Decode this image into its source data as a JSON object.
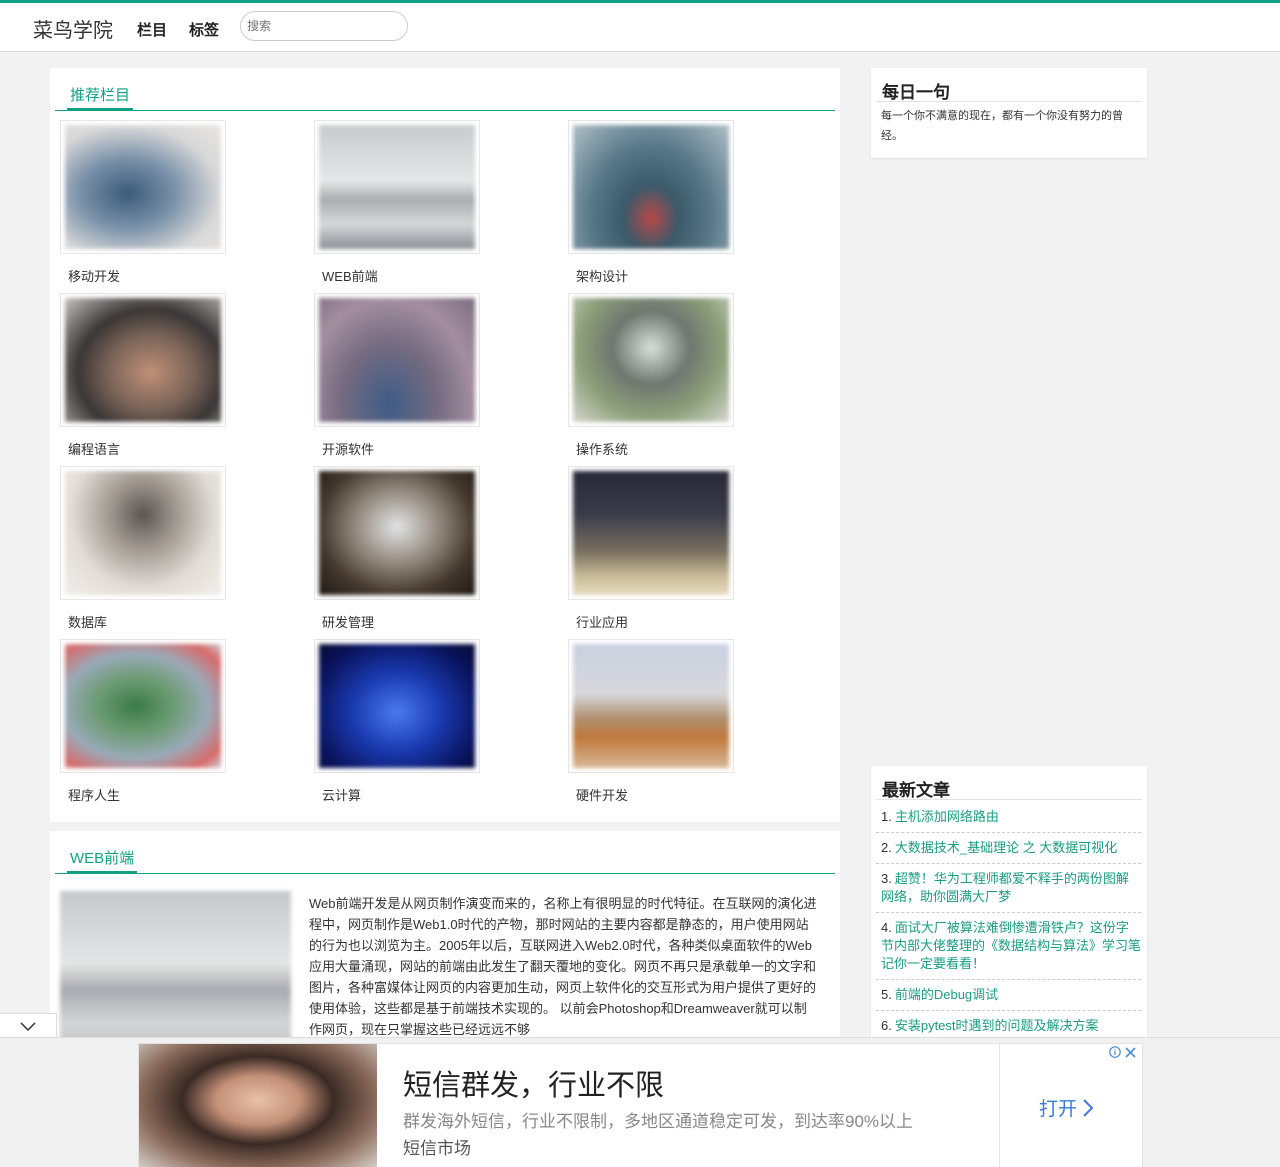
{
  "header": {
    "brand": "菜鸟学院",
    "nav": {
      "columns": "栏目",
      "tags": "标签"
    },
    "search_placeholder": "搜索"
  },
  "recommend": {
    "title": "推荐栏目",
    "categories": [
      {
        "label": "移动开发"
      },
      {
        "label": "WEB前端"
      },
      {
        "label": "架构设计"
      },
      {
        "label": "编程语言"
      },
      {
        "label": "开源软件"
      },
      {
        "label": "操作系统"
      },
      {
        "label": "数据库"
      },
      {
        "label": "研发管理"
      },
      {
        "label": "行业应用"
      },
      {
        "label": "程序人生"
      },
      {
        "label": "云计算"
      },
      {
        "label": "硬件开发"
      }
    ]
  },
  "web_section": {
    "title": "WEB前端",
    "intro": "Web前端开发是从网页制作演变而来的，名称上有很明显的时代特征。在互联网的演化进程中，网页制作是Web1.0时代的产物，那时网站的主要内容都是静态的，用户使用网站的行为也以浏览为主。2005年以后，互联网进入Web2.0时代，各种类似桌面软件的Web应用大量涌现，网站的前端由此发生了翻天覆地的变化。网页不再只是承载单一的文字和图片，各种富媒体让网页的内容更加生动，网页上软件化的交互形式为用户提供了更好的使用体验，这些都是基于前端技术实现的。 以前会Photoshop和Dreamweaver就可以制作网页，现在只掌握这些已经远远不够"
  },
  "sidebar": {
    "quote": {
      "title": "每日一句",
      "text": "每一个你不满意的现在，都有一个你没有努力的曾经。"
    },
    "latest": {
      "title": "最新文章",
      "items": [
        {
          "num": "1.",
          "title": "主机添加网络路由"
        },
        {
          "num": "2.",
          "title": "大数据技术_基础理论 之 大数据可视化"
        },
        {
          "num": "3.",
          "title": "超赞！华为工程师都爱不释手的两份图解网络，助你圆满大厂梦"
        },
        {
          "num": "4.",
          "title": "面试大厂被算法难倒惨遭滑铁卢？这份字节内部大佬整理的《数据结构与算法》学习笔记你一定要看看！"
        },
        {
          "num": "5.",
          "title": "前端的Debug调试"
        },
        {
          "num": "6.",
          "title": "安装pytest时遇到的问题及解决方案"
        }
      ]
    }
  },
  "ad": {
    "headline": "短信群发，行业不限",
    "description": "群发海外短信，行业不限制，多地区通道稳定可发，到达率90%以上",
    "source": "短信市场",
    "cta": "打开"
  },
  "colors": {
    "accent": "#12a085",
    "link": "#1a9c84",
    "ad_cta": "#3a7ad8"
  }
}
